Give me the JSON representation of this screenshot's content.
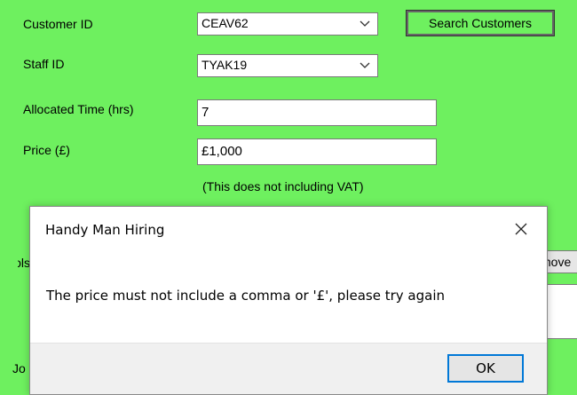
{
  "form": {
    "customer_id_label": "Customer ID",
    "customer_id_value": "CEAV62",
    "search_button_label": "Search Customers",
    "staff_id_label": "Staff ID",
    "staff_id_value": "TYAK19",
    "allocated_time_label": "Allocated Time (hrs)",
    "allocated_time_value": "7",
    "price_label": "Price (£)",
    "price_value": "£1,000",
    "vat_note": "(This does not including VAT)",
    "tools_label_partial": "ols",
    "remove_button_partial": "move",
    "job_label_partial": "Jo"
  },
  "dialog": {
    "title": "Handy Man Hiring",
    "message": "The price must not include a comma or '£', please try again",
    "ok_label": "OK"
  },
  "colors": {
    "form_background": "#6ef05f",
    "dialog_background": "#ffffff",
    "dialog_footer": "#f0f0f0",
    "ok_border": "#0078d7"
  }
}
